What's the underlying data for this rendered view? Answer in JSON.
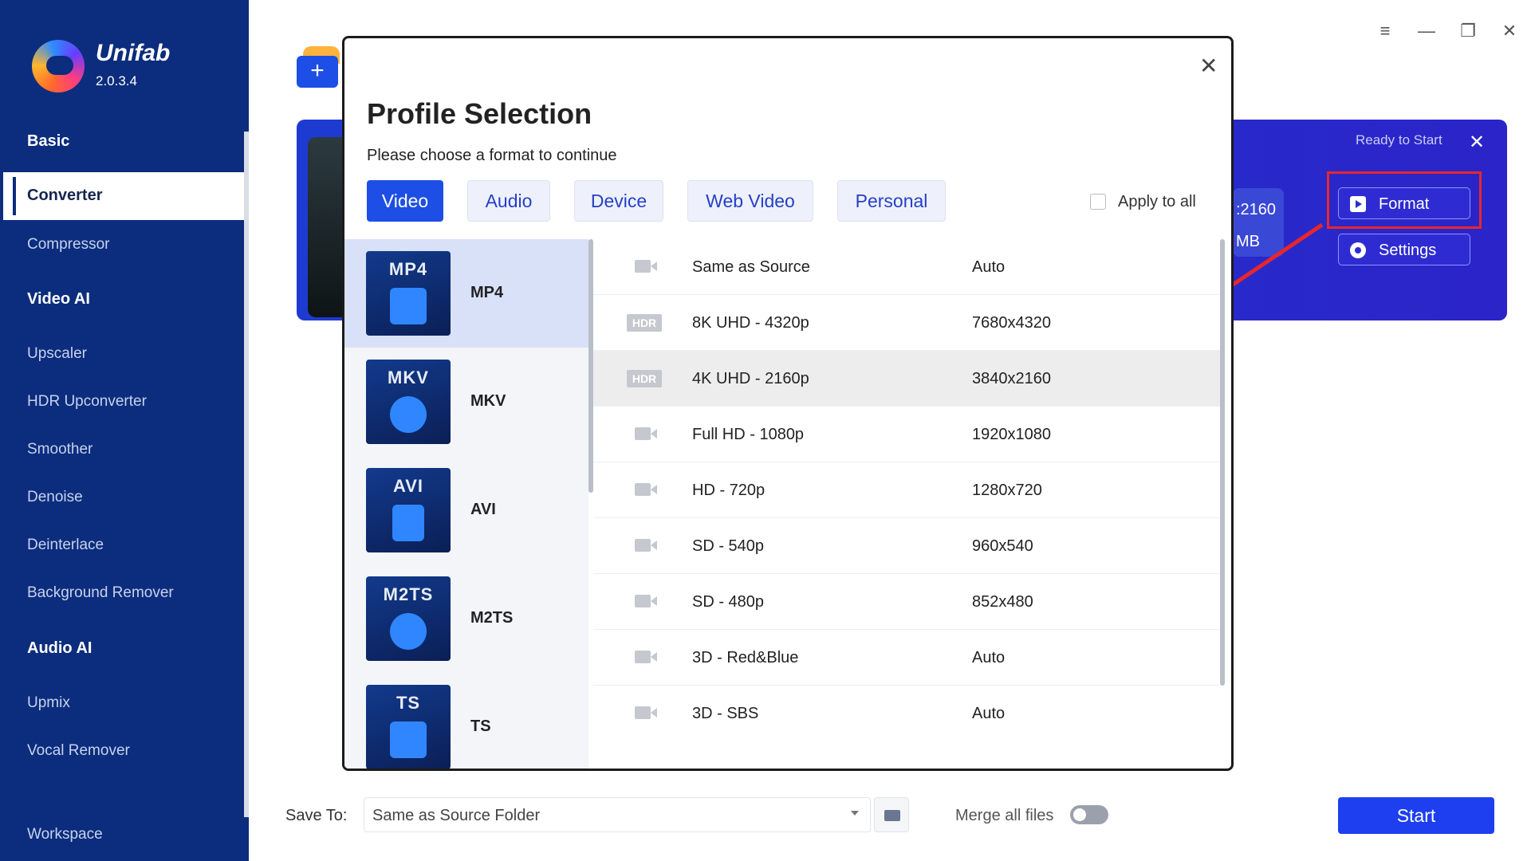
{
  "app": {
    "name": "Unifab",
    "version": "2.0.3.4"
  },
  "sidebar": {
    "sections": [
      {
        "title": "Basic",
        "items": [
          "Converter",
          "Compressor"
        ]
      },
      {
        "title": "Video AI",
        "items": [
          "Upscaler",
          "HDR Upconverter",
          "Smoother",
          "Denoise",
          "Deinterlace",
          "Background Remover"
        ]
      },
      {
        "title": "Audio AI",
        "items": [
          "Upmix",
          "Vocal Remover"
        ]
      }
    ],
    "active": "Converter",
    "bottom": "Workspace"
  },
  "window_controls": [
    "menu-icon",
    "minimize-icon",
    "restore-icon",
    "close-icon"
  ],
  "task_card": {
    "status": "Ready to Start",
    "resolution_partial": ":2160",
    "size_partial": "MB",
    "format_button": "Format",
    "settings_button": "Settings"
  },
  "bottom_bar": {
    "save_to_label": "Save To:",
    "save_to_value": "Same as Source Folder",
    "merge_label": "Merge all files",
    "start_button": "Start"
  },
  "modal": {
    "title": "Profile Selection",
    "subtitle": "Please choose a format to continue",
    "tabs": [
      "Video",
      "Audio",
      "Device",
      "Web Video",
      "Personal"
    ],
    "active_tab": "Video",
    "apply_to_all": "Apply to all",
    "formats": [
      {
        "tag": "MP4",
        "name": "MP4"
      },
      {
        "tag": "MKV",
        "name": "MKV"
      },
      {
        "tag": "AVI",
        "name": "AVI"
      },
      {
        "tag": "M2TS",
        "name": "M2TS"
      },
      {
        "tag": "TS",
        "name": "TS"
      }
    ],
    "active_format": "MP4",
    "profiles": [
      {
        "icon": "video-camera-icon",
        "name": "Same as Source",
        "value": "Auto"
      },
      {
        "icon": "hdr-badge",
        "badge": "HDR",
        "name": "8K UHD - 4320p",
        "value": "7680x4320"
      },
      {
        "icon": "hdr-badge",
        "badge": "HDR",
        "name": "4K UHD - 2160p",
        "value": "3840x2160"
      },
      {
        "icon": "video-camera-icon",
        "name": "Full HD - 1080p",
        "value": "1920x1080"
      },
      {
        "icon": "video-camera-icon",
        "name": "HD - 720p",
        "value": "1280x720"
      },
      {
        "icon": "video-camera-icon",
        "name": "SD - 540p",
        "value": "960x540"
      },
      {
        "icon": "video-camera-icon",
        "name": "SD - 480p",
        "value": "852x480"
      },
      {
        "icon": "video-camera-icon",
        "name": "3D - Red&Blue",
        "value": "Auto"
      },
      {
        "icon": "video-camera-icon",
        "name": "3D - SBS",
        "value": "Auto"
      }
    ],
    "selected_profile": "4K UHD - 2160p"
  },
  "colors": {
    "sidebar": "#0c2d7d",
    "accent": "#1d4fe6",
    "task_card": "#2b24c8",
    "highlight": "#e8262c"
  }
}
